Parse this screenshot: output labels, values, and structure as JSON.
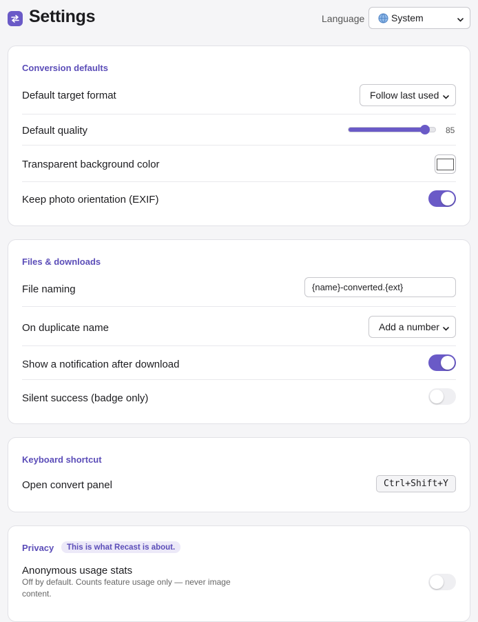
{
  "header": {
    "title": "Settings",
    "language_label": "Language",
    "language_value": "System",
    "app_icon": "swap-arrows-icon",
    "language_icon": "globe-icon"
  },
  "accent_color": "#6a5ac7",
  "conversion": {
    "title": "Conversion defaults",
    "target_format_label": "Default target format",
    "target_format_value": "Follow last used",
    "quality_label": "Default quality",
    "quality_value": "85",
    "quality_fraction": 0.85,
    "transparent_label": "Transparent background color",
    "transparent_color": "#ffffff",
    "exif_label": "Keep photo orientation (EXIF)",
    "exif_on": true
  },
  "files": {
    "title": "Files & downloads",
    "naming_label": "File naming",
    "naming_value": "{name}-converted.{ext}",
    "duplicate_label": "On duplicate name",
    "duplicate_value": "Add a number",
    "notify_label": "Show a notification after download",
    "notify_on": true,
    "silent_label": "Silent success (badge only)",
    "silent_on": false
  },
  "shortcut": {
    "title": "Keyboard shortcut",
    "open_panel_label": "Open convert panel",
    "open_panel_keys": "Ctrl+Shift+Y"
  },
  "privacy": {
    "title": "Privacy",
    "badge": "This is what Recast is about.",
    "stats_label": "Anonymous usage stats",
    "stats_desc": "Off by default. Counts feature usage only — never image content.",
    "stats_on": false
  }
}
